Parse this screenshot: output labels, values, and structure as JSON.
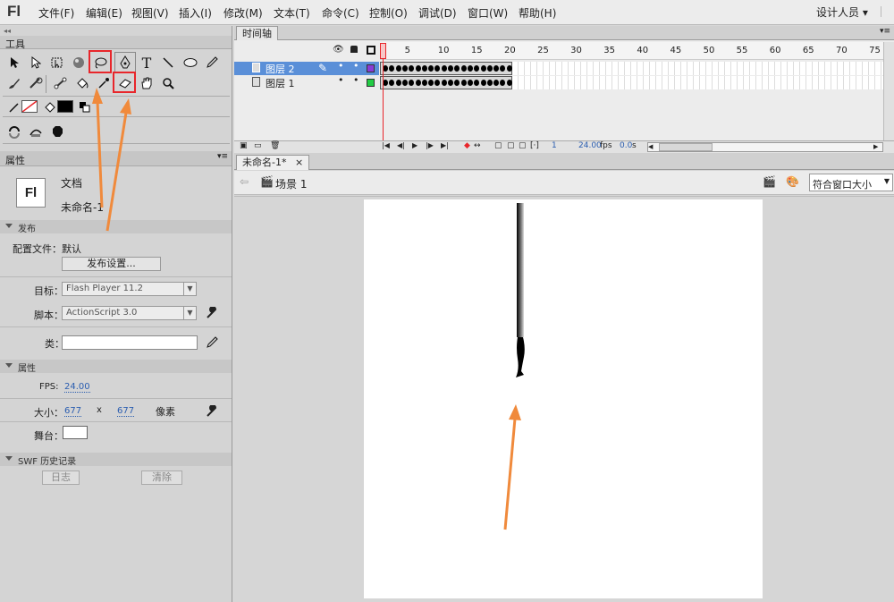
{
  "app": {
    "logo": "Fl",
    "workspace": "设计人员",
    "workspace_caret": "▾"
  },
  "menu": [
    "文件(F)",
    "编辑(E)",
    "视图(V)",
    "插入(I)",
    "修改(M)",
    "文本(T)",
    "命令(C)",
    "控制(O)",
    "调试(D)",
    "窗口(W)",
    "帮助(H)"
  ],
  "tools": {
    "title": "工具"
  },
  "properties": {
    "title": "属性",
    "doc_type": "文档",
    "doc_name": "未命名-1",
    "doc_icon": "Fl",
    "publish_section": "发布",
    "profile_label": "配置文件：",
    "profile_value": "默认",
    "publish_settings": "发布设置...",
    "target_label": "目标：",
    "target_value": "Flash Player 11.2",
    "script_label": "脚本：",
    "script_value": "ActionScript 3.0",
    "class_label": "类：",
    "props_section": "属性",
    "fps_label": "FPS:",
    "fps_value": "24.00",
    "size_label": "大小：",
    "width": "677",
    "x": "x",
    "height": "677",
    "unit": "像素",
    "stage_label": "舞台：",
    "swf_section": "SWF 历史记录",
    "log_btn": "日志",
    "clear_btn": "清除"
  },
  "timeline": {
    "title": "时间轴",
    "frame_numbers": [
      "1",
      "5",
      "10",
      "15",
      "20",
      "25",
      "30",
      "35",
      "40",
      "45",
      "50",
      "55",
      "60",
      "65",
      "70",
      "75"
    ],
    "layers": [
      {
        "name": "图层 2",
        "color": "#8a3bd6",
        "selected": true
      },
      {
        "name": "图层 1",
        "color": "#22cc44",
        "selected": false
      }
    ],
    "status_frame": "1",
    "status_fps": "24.00",
    "fps_unit": "fps",
    "status_time": "0.0",
    "time_unit": "s"
  },
  "document": {
    "tab": "未命名-1*",
    "tab_close": "×",
    "scene": "场景 1",
    "zoom": "符合窗口大小"
  },
  "colors": {
    "accent_red": "#e8262b",
    "arrow_orange": "#f08a3c",
    "selected_layer": "#5a8fd8"
  }
}
